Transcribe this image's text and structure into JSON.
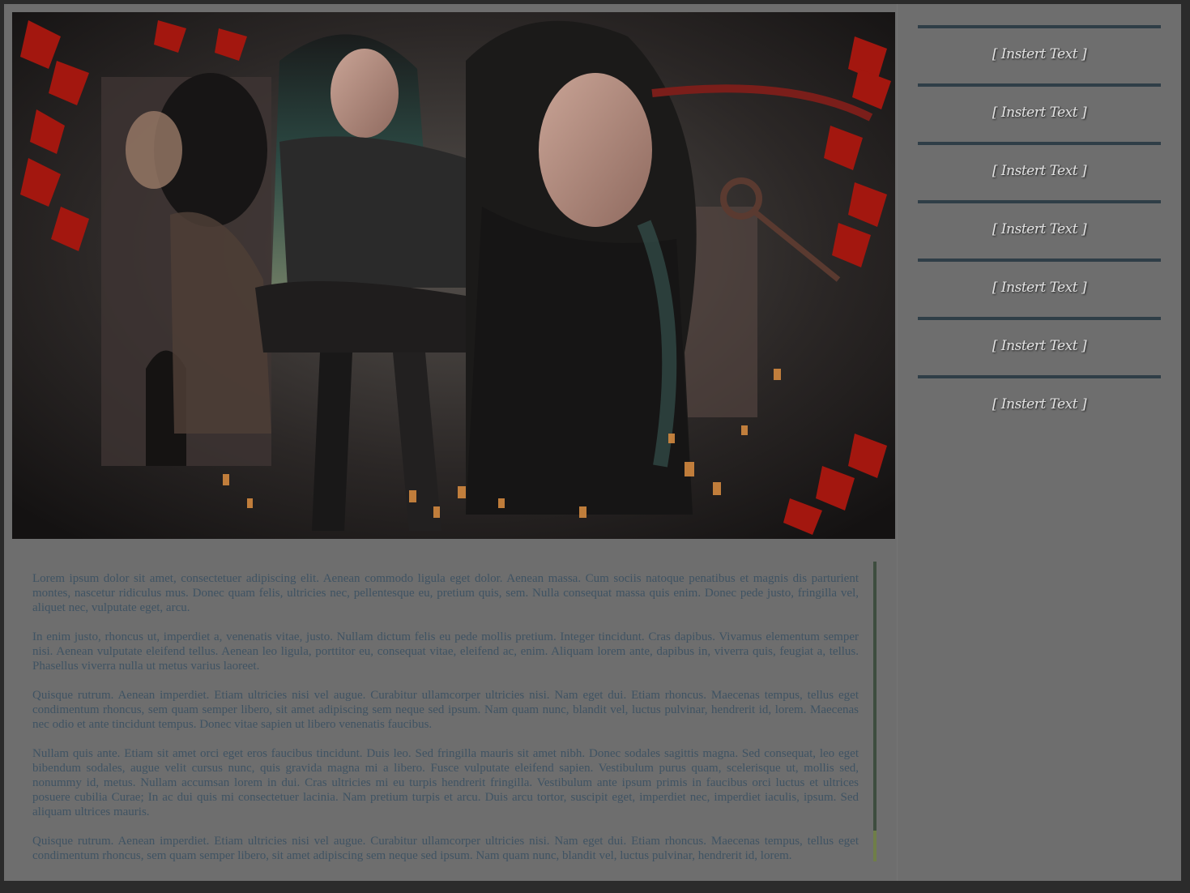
{
  "sidebar": {
    "items": [
      {
        "label": "[ Instert Text ]"
      },
      {
        "label": "[ Instert Text ]"
      },
      {
        "label": "[ Instert Text ]"
      },
      {
        "label": "[ Instert Text ]"
      },
      {
        "label": "[ Instert Text ]"
      },
      {
        "label": "[ Instert Text ]"
      },
      {
        "label": "[ Instert Text ]"
      }
    ]
  },
  "main": {
    "paragraphs": [
      "Lorem ipsum dolor sit amet, consectetuer adipiscing elit. Aenean commodo ligula eget dolor. Aenean massa. Cum sociis natoque penatibus et magnis dis parturient montes, nascetur ridiculus mus. Donec quam felis, ultricies nec, pellentesque eu, pretium quis, sem. Nulla consequat massa quis enim. Donec pede justo, fringilla vel, aliquet nec, vulputate eget, arcu.",
      "In enim justo, rhoncus ut, imperdiet a, venenatis vitae, justo. Nullam dictum felis eu pede mollis pretium. Integer tincidunt. Cras dapibus. Vivamus elementum semper nisi. Aenean vulputate eleifend tellus. Aenean leo ligula, porttitor eu, consequat vitae, eleifend ac, enim. Aliquam lorem ante, dapibus in, viverra quis, feugiat a, tellus. Phasellus viverra nulla ut metus varius laoreet.",
      "Quisque rutrum. Aenean imperdiet. Etiam ultricies nisi vel augue. Curabitur ullamcorper ultricies nisi. Nam eget dui. Etiam rhoncus. Maecenas tempus, tellus eget condimentum rhoncus, sem quam semper libero, sit amet adipiscing sem neque sed ipsum. Nam quam nunc, blandit vel, luctus pulvinar, hendrerit id, lorem. Maecenas nec odio et ante tincidunt tempus. Donec vitae sapien ut libero venenatis faucibus.",
      "Nullam quis ante. Etiam sit amet orci eget eros faucibus tincidunt. Duis leo. Sed fringilla mauris sit amet nibh. Donec sodales sagittis magna. Sed consequat, leo eget bibendum sodales, augue velit cursus nunc, quis gravida magna mi a libero. Fusce vulputate eleifend sapien. Vestibulum purus quam, scelerisque ut, mollis sed, nonummy id, metus. Nullam accumsan lorem in dui. Cras ultricies mi eu turpis hendrerit fringilla. Vestibulum ante ipsum primis in faucibus orci luctus et ultrices posuere cubilia Curae; In ac dui quis mi consectetuer lacinia. Nam pretium turpis et arcu. Duis arcu tortor, suscipit eget, imperdiet nec, imperdiet iaculis, ipsum. Sed aliquam ultrices mauris.",
      "Quisque rutrum. Aenean imperdiet. Etiam ultricies nisi vel augue. Curabitur ullamcorper ultricies nisi. Nam eget dui. Etiam rhoncus. Maecenas tempus, tellus eget condimentum rhoncus, sem quam semper libero, sit amet adipiscing sem neque sed ipsum. Nam quam nunc, blandit vel, luctus pulvinar, hendrerit id, lorem."
    ],
    "scroll_position": 0.1
  },
  "colors": {
    "page_background": "#2b2b2b",
    "panel": "#6e6e6e",
    "body_text": "#3f5363",
    "nav_divider": "#2f3e47",
    "nav_text": "#e3e3e3",
    "scrollbar_track": "#6f7e48",
    "scrollbar_thumb": "#3e4d3f",
    "accent_red": "#a3170f"
  }
}
